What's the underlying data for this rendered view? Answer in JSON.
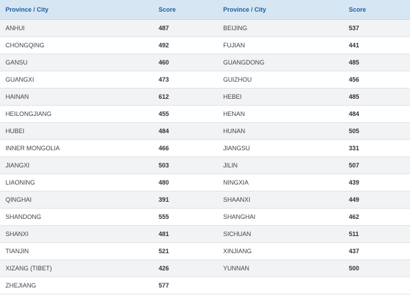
{
  "table": {
    "headers": [
      "Province / City",
      "Score",
      "Province / City",
      "Score"
    ],
    "rows": [
      [
        "ANHUI",
        "487",
        "BEIJING",
        "537"
      ],
      [
        "CHONGQING",
        "492",
        "FUJIAN",
        "441"
      ],
      [
        "GANSU",
        "460",
        "GUANGDONG",
        "485"
      ],
      [
        "GUANGXI",
        "473",
        "GUIZHOU",
        "456"
      ],
      [
        "HAINAN",
        "612",
        "HEBEI",
        "485"
      ],
      [
        "HEILONGJIANG",
        "455",
        "HENAN",
        "484"
      ],
      [
        "HUBEI",
        "484",
        "HUNAN",
        "505"
      ],
      [
        "INNER MONGOLIA",
        "466",
        "JIANGSU",
        "331"
      ],
      [
        "JIANGXI",
        "503",
        "JILIN",
        "507"
      ],
      [
        "LIAONING",
        "480",
        "NINGXIA",
        "439"
      ],
      [
        "QINGHAI",
        "391",
        "SHAANXI",
        "449"
      ],
      [
        "SHANDONG",
        "555",
        "SHANGHAI",
        "462"
      ],
      [
        "SHANXI",
        "481",
        "SICHUAN",
        "511"
      ],
      [
        "TIANJIN",
        "521",
        "XINJIANG",
        "437"
      ],
      [
        "XIZANG (TIBET)",
        "426",
        "YUNNAN",
        "500"
      ],
      [
        "ZHEJIANG",
        "577",
        "",
        ""
      ]
    ]
  },
  "colors": {
    "header_bg": "#d6e6f3",
    "header_text": "#1f5fa0",
    "row_stripe": "#f1f3f5",
    "border": "#dde4ea"
  }
}
